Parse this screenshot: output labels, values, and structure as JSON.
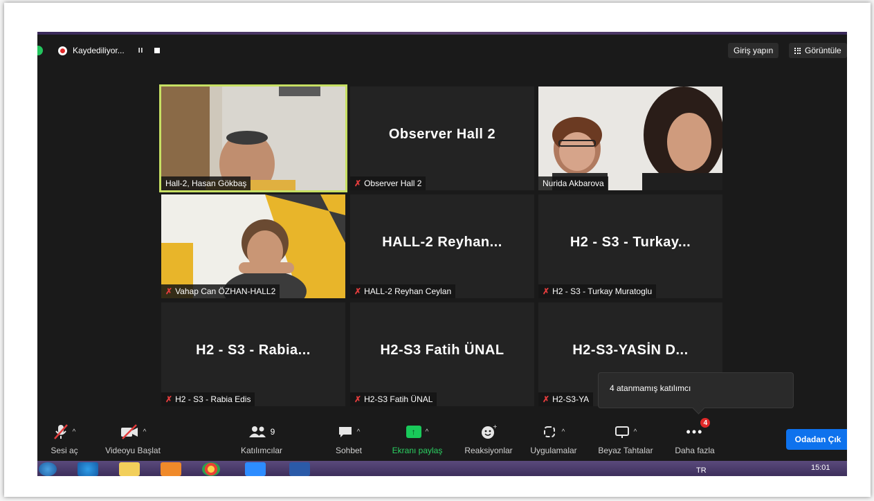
{
  "top_bar": {
    "recording_label": "Kaydediliyor...",
    "pause_label": "II",
    "signin_label": "Giriş yapın",
    "view_label": "Görüntüle"
  },
  "tiles": [
    {
      "id": "hasan",
      "name": "Hall-2, Hasan Gökbaş",
      "display": "",
      "video": true,
      "muted": false,
      "active": true
    },
    {
      "id": "observer",
      "name": "Observer Hall 2",
      "display": "Observer Hall 2",
      "video": false,
      "muted": true,
      "active": false
    },
    {
      "id": "nurida",
      "name": "Nurida Akbarova",
      "display": "",
      "video": true,
      "muted": false,
      "active": false
    },
    {
      "id": "vahap",
      "name": "Vahap Can ÖZHAN-HALL2",
      "display": "",
      "video": true,
      "muted": true,
      "active": false
    },
    {
      "id": "reyhan",
      "name": "HALL-2 Reyhan Ceylan",
      "display": "HALL-2  Reyhan...",
      "video": false,
      "muted": true,
      "active": false
    },
    {
      "id": "turkay",
      "name": "H2 - S3 - Turkay Muratoglu",
      "display": "H2 - S3 - Turkay...",
      "video": false,
      "muted": true,
      "active": false
    },
    {
      "id": "rabia",
      "name": "H2 - S3 - Rabia Edis",
      "display": "H2 - S3 - Rabia...",
      "video": false,
      "muted": true,
      "active": false
    },
    {
      "id": "fatih",
      "name": "H2-S3 Fatih ÜNAL",
      "display": "H2-S3 Fatih ÜNAL",
      "video": false,
      "muted": true,
      "active": false
    },
    {
      "id": "yasin",
      "name": "H2-S3-YA",
      "display": "H2-S3-YASİN  D...",
      "video": false,
      "muted": true,
      "active": false
    }
  ],
  "tooltip": {
    "text": "4 atanmamış katılımcı"
  },
  "toolbar": {
    "unmute": "Sesi aç",
    "start_video": "Videoyu Başlat",
    "participants": "Katılımcılar",
    "participants_count": "9",
    "chat": "Sohbet",
    "share": "Ekranı paylaş",
    "reactions": "Reaksiyonlar",
    "apps": "Uygulamalar",
    "whiteboards": "Beyaz Tahtalar",
    "more": "Daha fazla",
    "more_badge": "4",
    "leave": "Odadan Çık"
  },
  "taskbar": {
    "time": "15:01",
    "lang": "TR"
  }
}
